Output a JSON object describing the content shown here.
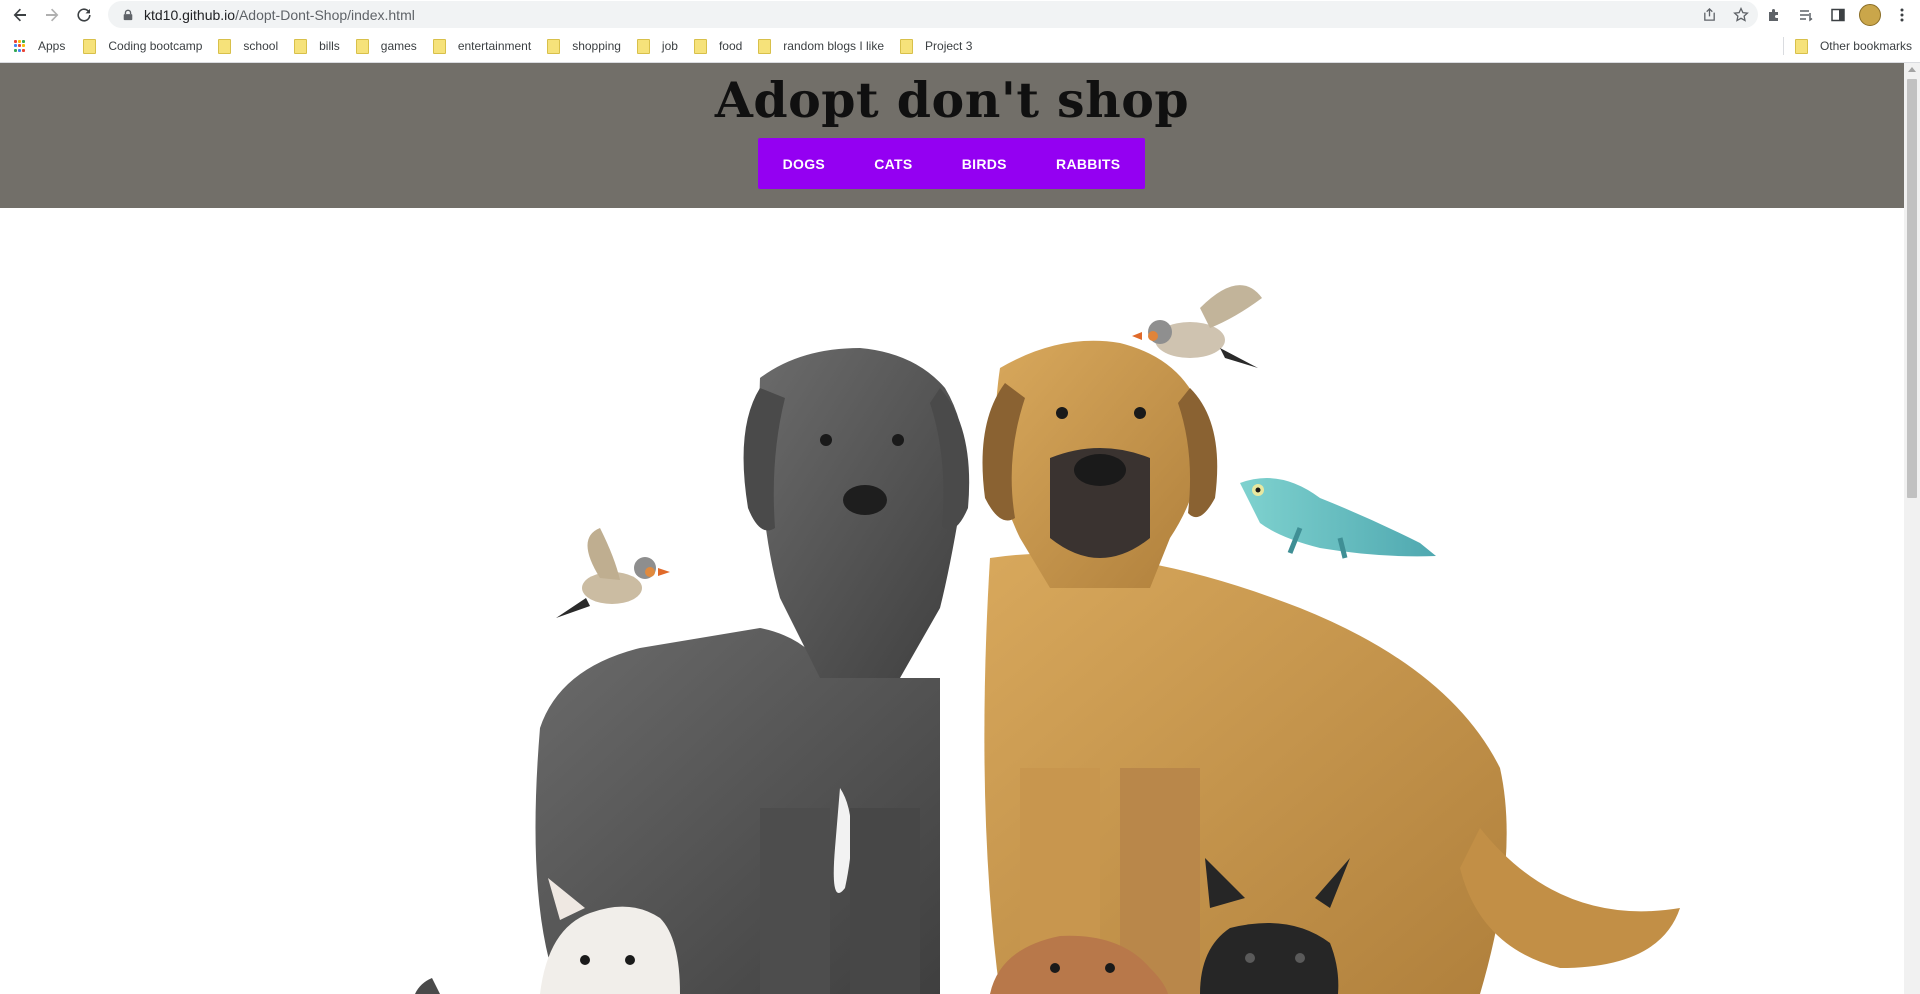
{
  "browser": {
    "url_host": "ktd10.github.io",
    "url_path": "/Adopt-Dont-Shop/index.html",
    "bookmarks": [
      {
        "label": "Apps"
      },
      {
        "label": "Coding bootcamp"
      },
      {
        "label": "school"
      },
      {
        "label": "bills"
      },
      {
        "label": "games"
      },
      {
        "label": "entertainment"
      },
      {
        "label": "shopping"
      },
      {
        "label": "job"
      },
      {
        "label": "food"
      },
      {
        "label": "random blogs I like"
      },
      {
        "label": "Project 3"
      }
    ],
    "other_bookmarks": "Other bookmarks",
    "icons": [
      "back-icon",
      "forward-icon",
      "reload-icon",
      "lock-icon",
      "share-icon",
      "star-icon",
      "extensions-icon",
      "reading-list-icon",
      "side-panel-icon",
      "profile-avatar",
      "menu-icon"
    ]
  },
  "site": {
    "title": "Adopt don't shop",
    "nav": [
      "DOGS",
      "CATS",
      "BIRDS",
      "RABBITS"
    ],
    "header_color": "#726f69",
    "nav_color": "#9400f2"
  }
}
